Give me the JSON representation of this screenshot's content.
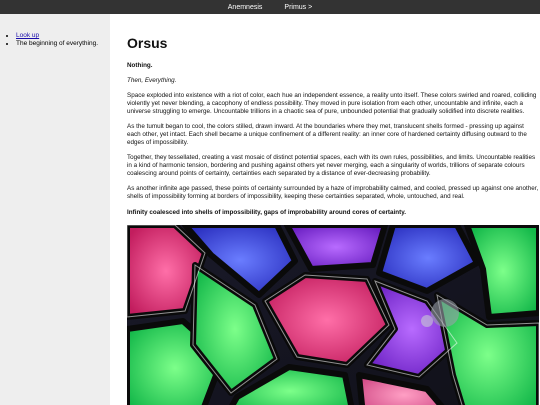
{
  "nav": {
    "links": [
      "Anemnesis",
      "Primus >"
    ]
  },
  "sidebar": {
    "items": [
      {
        "label": "Look up"
      },
      {
        "label": "The beginning of everything."
      }
    ]
  },
  "main": {
    "title": "Orsus",
    "p_nothing": "Nothing.",
    "p_then": "Then, Everything.",
    "p1": "Space exploded into existence with a riot of color, each hue an independent essence, a reality unto itself. These colors swirled and roared, colliding violently yet never blending, a cacophony of endless possibility. They moved in pure isolation from each other, uncountable and infinite, each a universe struggling to emerge. Uncountable trillions in a chaotic sea of pure, unbounded potential that gradually solidified into discrete realities.",
    "p2": "As the tumult began to cool, the colors stilled, drawn inward. At the boundaries where they met, translucent shells formed - pressing up against each other, yet intact. Each shell became a unique confinement of a different reality: an inner core of hardened certainty diffusing outward to the edges of impossibility.",
    "p3": "Together, they tessellated, creating a vast mosaic of distinct potential spaces, each with its own rules, possibilities, and limits. Uncountable realities in a kind of harmonic tension, bordering and pushing against others yet never merging, each a singularity of worlds, trillions of separate colours coalescing around points of certainty, certainties each separated by a distance of ever-decreasing probability.",
    "p4": "As another infinite age passed, these points of certainty surrounded by a haze of improbability calmed, and cooled, pressed up against one another, shells of impossibility forming at borders of impossibility, keeping these certainties separated, whole, untouched, and real.",
    "p5": "Infinity coalesced into shells of impossibility, gaps of improbability around cores of certainty."
  },
  "colors": {
    "topbar": "#333333",
    "sidebar": "#eeeeee",
    "link": "#1a0dab"
  }
}
